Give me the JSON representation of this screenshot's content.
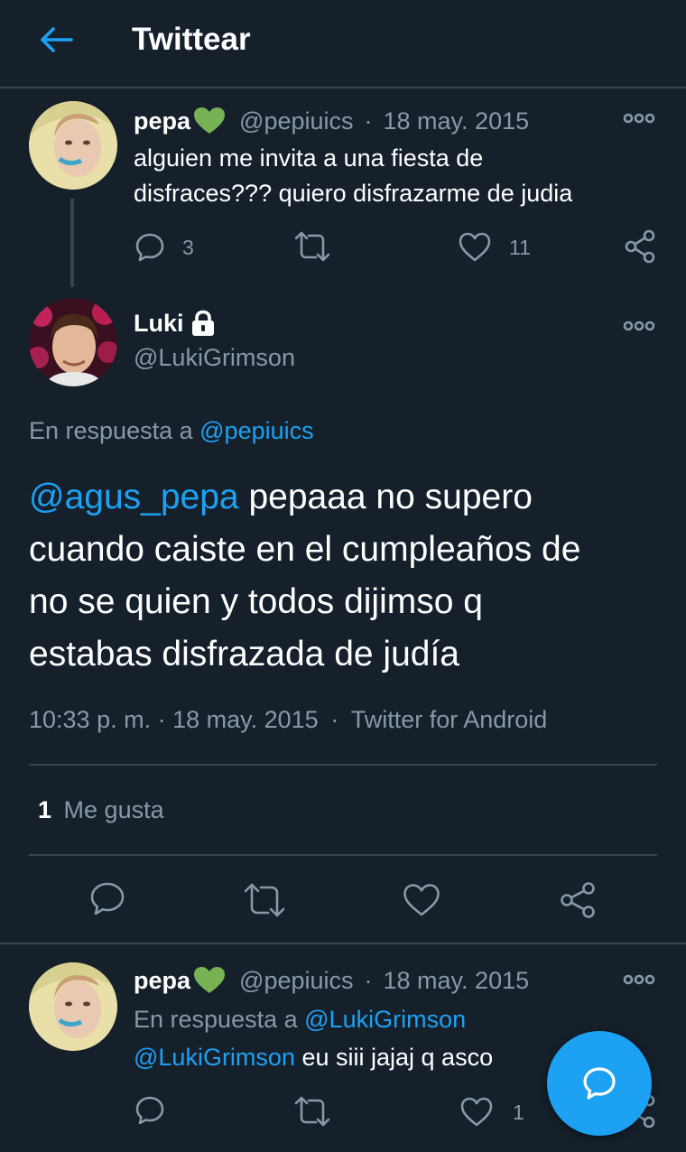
{
  "header": {
    "title": "Twittear"
  },
  "tweet1": {
    "name": "pepa",
    "handle": "@pepiuics",
    "sep": "·",
    "date": "18 may. 2015",
    "text_line1": "alguien me invita a una fiesta de",
    "text_line2": "disfraces??? quiero disfrazarme de judia",
    "reply_count": "3",
    "like_count": "11"
  },
  "main_tweet": {
    "name": "Luki",
    "handle": "@LukiGrimson",
    "reply_to_prefix": "En respuesta a",
    "reply_to_handle": "@pepiuics",
    "mention": "@agus_pepa",
    "text_after_mention": " pepaaa no supero",
    "text_line2": "cuando caiste en el cumpleaños de",
    "text_line3": "no se quien y todos dijimso q",
    "text_line4": "estabas disfrazada de judía",
    "meta_time": "10:33 p. m. · 18 may. 2015",
    "meta_sep": "·",
    "meta_source": "Twitter for Android",
    "likes_count": "1",
    "likes_label": "Me gusta"
  },
  "tweet3": {
    "name": "pepa",
    "handle": "@pepiuics",
    "sep": "·",
    "date": "18 may. 2015",
    "reply_to_prefix": "En respuesta a",
    "reply_to_handle": "@LukiGrimson",
    "mention": "@LukiGrimson",
    "text_after_mention": " eu siii jajaj q asco",
    "like_count": "1"
  },
  "colors": {
    "background": "#15202b",
    "accent": "#1da1f2",
    "muted": "#8899a6",
    "divider": "#38444d",
    "heart_emoji": "#77b255"
  },
  "icons": [
    "back-arrow-icon",
    "green-heart-icon",
    "lock-icon",
    "more-icon",
    "reply-icon",
    "retweet-icon",
    "like-icon",
    "share-icon",
    "compose-icon"
  ]
}
